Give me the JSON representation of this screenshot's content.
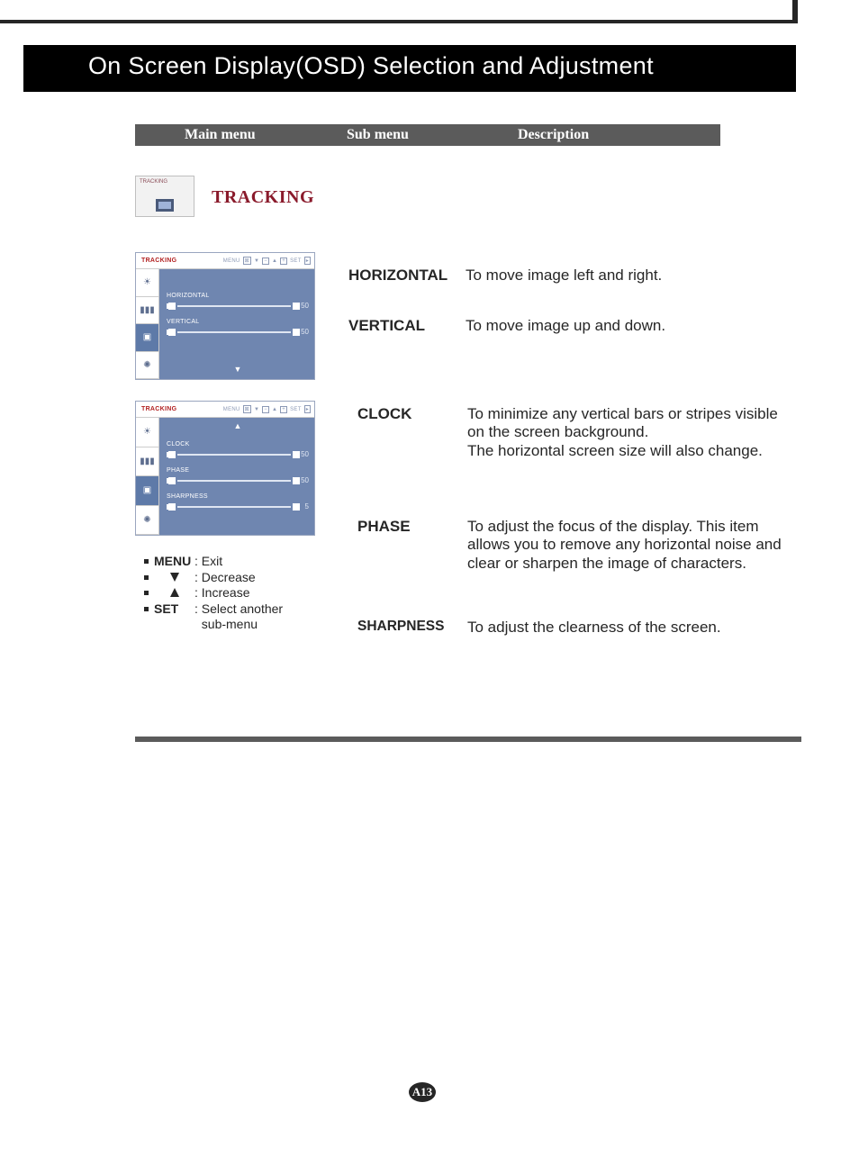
{
  "banner_title": "On Screen Display(OSD) Selection and Adjustment",
  "header": {
    "main": "Main menu",
    "sub": "Sub menu",
    "desc": "Description"
  },
  "icon_label": "TRACKING",
  "tracking_title": "TRACKING",
  "osd1": {
    "title": "TRACKING",
    "btn_menu": "MENU",
    "btn_set": "SET",
    "rows": [
      {
        "label": "HORIZONTAL",
        "value": "50"
      },
      {
        "label": "VERTICAL",
        "value": "50"
      }
    ]
  },
  "osd2": {
    "title": "TRACKING",
    "btn_menu": "MENU",
    "btn_set": "SET",
    "rows": [
      {
        "label": "CLOCK",
        "value": "50"
      },
      {
        "label": "PHASE",
        "value": "50"
      },
      {
        "label": "SHARPNESS",
        "value": "5"
      }
    ]
  },
  "descriptions": {
    "horizontal": {
      "term": "HORIZONTAL",
      "text": "To move image left and right."
    },
    "vertical": {
      "term": "VERTICAL",
      "text": "To move image up and down."
    },
    "clock": {
      "term": "CLOCK",
      "text": "To minimize any vertical bars or stripes visible on the screen background.\nThe horizontal screen size will also change."
    },
    "phase": {
      "term": "PHASE",
      "text": "To adjust the focus of the display. This item allows you to remove any horizontal noise and clear or sharpen the image of characters."
    },
    "sharpness": {
      "term": "SHARPNESS",
      "text": "To adjust the clearness of the screen."
    }
  },
  "legend": {
    "menu_key": "MENU",
    "menu_text": ": Exit",
    "down_text": ": Decrease",
    "up_text": ": Increase",
    "set_key": "SET",
    "set_text": ": Select another",
    "set_text2": "  sub-menu"
  },
  "page_number": "A13"
}
